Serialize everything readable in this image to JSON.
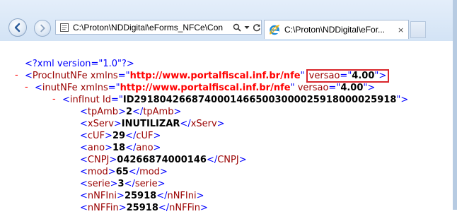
{
  "browser": {
    "address_text": "C:\\Proton\\NDDigital\\eForms_NFCe\\Con",
    "tab_title": "C:\\Proton\\NDDigital\\eFor...",
    "tab_close": "×",
    "address_controls": {
      "search": "search-icon",
      "dropdown": "chevron-down-icon",
      "refresh": "refresh-icon"
    },
    "accent_color": "#1e8ad6"
  },
  "xml": {
    "minus": "-",
    "lt": "<",
    "gt": ">",
    "close_lt": "</",
    "eq": "=",
    "quote": "\"",
    "space": " ",
    "declaration": "<?xml version=\"1.0\"?>",
    "proc": {
      "tag": "ProcInutNFe",
      "attr1_name": "xmlns",
      "attr1_value": "http://www.portalfiscal.inf.br/nfe",
      "attr2_name": "versao",
      "attr2_value": "4.00"
    },
    "inut": {
      "tag": "inutNFe",
      "attr1_name": "xmlns",
      "attr1_value": "http://www.portalfiscal.inf.br/nfe",
      "attr2_name": "versao",
      "attr2_value": "4.00"
    },
    "infInut": {
      "tag": "infInut",
      "attr_name": "Id",
      "attr_value": "ID29180426687400014665003000025918000025918"
    },
    "fields": [
      {
        "tag": "tpAmb",
        "value": "2"
      },
      {
        "tag": "xServ",
        "value": "INUTILIZAR"
      },
      {
        "tag": "cUF",
        "value": "29"
      },
      {
        "tag": "ano",
        "value": "18"
      },
      {
        "tag": "CNPJ",
        "value": "04266874000146"
      },
      {
        "tag": "mod",
        "value": "65"
      },
      {
        "tag": "serie",
        "value": "3"
      },
      {
        "tag": "nNFIni",
        "value": "25918"
      },
      {
        "tag": "nNFFin",
        "value": "25918"
      }
    ]
  }
}
